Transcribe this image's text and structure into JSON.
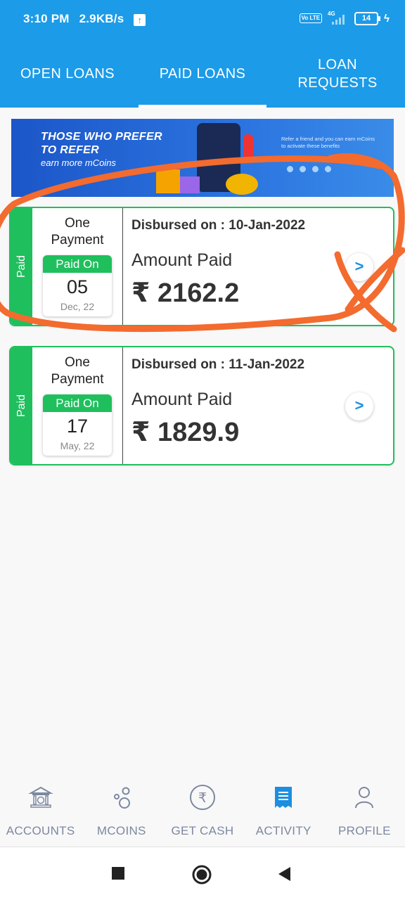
{
  "status_bar": {
    "time": "3:10 PM",
    "speed": "2.9KB/s",
    "upload_icon": "arrow-up",
    "volte": "Vo LTE",
    "network": "4G",
    "battery": "14"
  },
  "tabs": [
    {
      "label": "OPEN LOANS",
      "active": false
    },
    {
      "label": "PAID LOANS",
      "active": true
    },
    {
      "label": "LOAN REQUESTS",
      "active": false
    }
  ],
  "banner": {
    "headline_line1": "THOSE WHO PREFER",
    "headline_line2": "TO REFER",
    "sub": "earn more mCoins",
    "refer_text": "Refer a friend and you can earn mCoins to activate these benefits"
  },
  "loans": [
    {
      "status": "Paid",
      "plan_line1": "One",
      "plan_line2": "Payment",
      "paid_on_label": "Paid On",
      "day": "05",
      "month": "Dec, 22",
      "disbursed": "Disbursed on : 10-Jan-2022",
      "amount_label": "Amount Paid",
      "amount": "₹ 2162.2",
      "chevron": ">"
    },
    {
      "status": "Paid",
      "plan_line1": "One",
      "plan_line2": "Payment",
      "paid_on_label": "Paid On",
      "day": "17",
      "month": "May, 22",
      "disbursed": "Disbursed on : 11-Jan-2022",
      "amount_label": "Amount Paid",
      "amount": "₹ 1829.9",
      "chevron": ">"
    }
  ],
  "bottom_nav": [
    {
      "label": "ACCOUNTS",
      "icon": "bank-icon",
      "active": false
    },
    {
      "label": "MCOINS",
      "icon": "coins-icon",
      "active": false
    },
    {
      "label": "GET CASH",
      "icon": "rupee-icon",
      "active": false
    },
    {
      "label": "ACTIVITY",
      "icon": "receipt-icon",
      "active": true
    },
    {
      "label": "PROFILE",
      "icon": "person-icon",
      "active": false
    }
  ],
  "colors": {
    "header": "#1c9be8",
    "paid_green": "#1fbf5d",
    "annotation": "#f36b2f",
    "nav_active": "#1c8fe0",
    "nav_inactive": "#7c88a0"
  }
}
